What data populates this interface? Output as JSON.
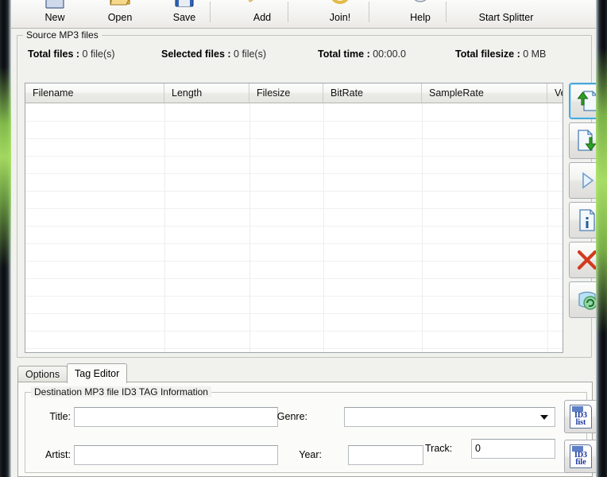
{
  "toolbar": {
    "items": [
      {
        "label": "New",
        "icon": "new-document-icon"
      },
      {
        "label": "Open",
        "icon": "open-folder-icon"
      },
      {
        "label": "Save",
        "icon": "save-disk-icon"
      },
      {
        "label": "Add",
        "icon": "add-file-icon"
      },
      {
        "label": "Join!",
        "icon": "join-icon"
      },
      {
        "label": "Help",
        "icon": "help-icon"
      },
      {
        "label": "Start Splitter",
        "icon": "start-splitter-icon"
      }
    ]
  },
  "source_group": {
    "title": "Source MP3 files",
    "stats": [
      {
        "label": "Total files :",
        "value": "0 file(s)"
      },
      {
        "label": "Selected files :",
        "value": "0 file(s)"
      },
      {
        "label": "Total time :",
        "value": "00:00.0"
      },
      {
        "label": "Total filesize :",
        "value": "0 MB"
      }
    ],
    "columns": [
      "Filename",
      "Length",
      "Filesize",
      "BitRate",
      "SampleRate",
      "Ve"
    ],
    "rows": []
  },
  "side_buttons": [
    {
      "name": "move-up-button",
      "icon": "document-arrow-up-icon",
      "selected": true
    },
    {
      "name": "move-down-button",
      "icon": "document-arrow-down-icon",
      "selected": false
    },
    {
      "name": "play-button",
      "icon": "play-triangle-icon",
      "selected": false
    },
    {
      "name": "info-button",
      "icon": "document-info-icon",
      "selected": false
    },
    {
      "name": "delete-button",
      "icon": "red-x-icon",
      "selected": false
    },
    {
      "name": "refresh-button",
      "icon": "recycle-refresh-icon",
      "selected": false
    }
  ],
  "tabs": [
    {
      "label": "Options",
      "active": false
    },
    {
      "label": "Tag Editor",
      "active": true
    }
  ],
  "tag_editor": {
    "group_title": "Destination MP3 file ID3 TAG Information",
    "fields": {
      "title": {
        "label": "Title:",
        "value": "",
        "placeholder": ""
      },
      "artist": {
        "label": "Artist:",
        "value": "",
        "placeholder": ""
      },
      "genre": {
        "label": "Genre:",
        "value": "",
        "placeholder": ""
      },
      "year": {
        "label": "Year:",
        "value": "",
        "placeholder": ""
      },
      "track": {
        "label": "Track:",
        "value": "0",
        "placeholder": ""
      }
    },
    "buttons": [
      {
        "name": "id3-list-button",
        "line1": "ID3",
        "line2": "list"
      },
      {
        "name": "id3-file-button",
        "line1": "ID3",
        "line2": "file"
      }
    ]
  },
  "colors": {
    "accent_selected": "#4aa7d8",
    "glow": "#96d755",
    "client_bg": "#f1f1ee",
    "delete_red": "#d23b1e",
    "arrow_green": "#2f9e28",
    "id3_blue": "#16309a"
  }
}
